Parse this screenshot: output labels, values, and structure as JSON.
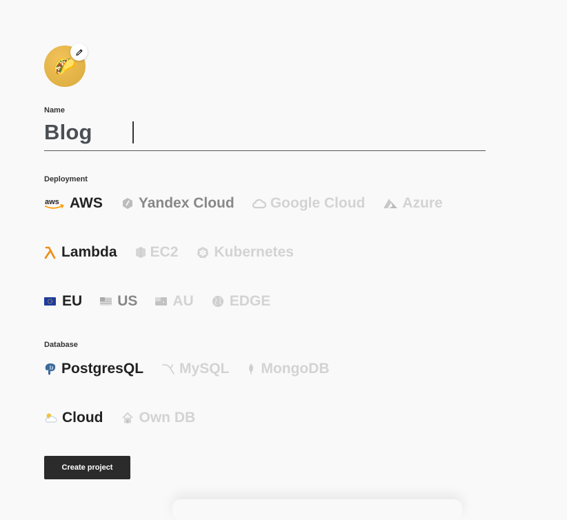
{
  "avatar": {
    "emoji": "🌮",
    "edit_icon": "pencil-icon"
  },
  "name": {
    "label": "Name",
    "value": "Blog"
  },
  "deployment": {
    "label": "Deployment",
    "providers": [
      {
        "label": "AWS",
        "icon": "aws-icon",
        "state": "active"
      },
      {
        "label": "Yandex Cloud",
        "icon": "yandex-cloud-icon",
        "state": "semi"
      },
      {
        "label": "Google Cloud",
        "icon": "google-cloud-icon",
        "state": "faded"
      },
      {
        "label": "Azure",
        "icon": "azure-icon",
        "state": "faded"
      }
    ],
    "compute": [
      {
        "label": "Lambda",
        "icon": "lambda-icon",
        "state": "active"
      },
      {
        "label": "EC2",
        "icon": "ec2-icon",
        "state": "faded"
      },
      {
        "label": "Kubernetes",
        "icon": "kubernetes-icon",
        "state": "faded"
      }
    ],
    "regions": [
      {
        "label": "EU",
        "icon": "eu-flag-icon",
        "state": "active"
      },
      {
        "label": "US",
        "icon": "us-flag-icon",
        "state": "semi"
      },
      {
        "label": "AU",
        "icon": "au-flag-icon",
        "state": "faded"
      },
      {
        "label": "EDGE",
        "icon": "globe-icon",
        "state": "faded"
      }
    ]
  },
  "database": {
    "label": "Database",
    "engines": [
      {
        "label": "PostgresQL",
        "icon": "postgresql-icon",
        "state": "active"
      },
      {
        "label": "MySQL",
        "icon": "mysql-icon",
        "state": "faded"
      },
      {
        "label": "MongoDB",
        "icon": "mongodb-icon",
        "state": "faded"
      }
    ],
    "hosting": [
      {
        "label": "Cloud",
        "icon": "cloud-sun-icon",
        "state": "active"
      },
      {
        "label": "Own DB",
        "icon": "house-icon",
        "state": "faded"
      }
    ]
  },
  "create_button": {
    "label": "Create project"
  },
  "colors": {
    "accent_orange": "#f90",
    "text_active": "#222",
    "text_faded": "#d3d3d3",
    "button_bg": "#2b2b2b"
  }
}
